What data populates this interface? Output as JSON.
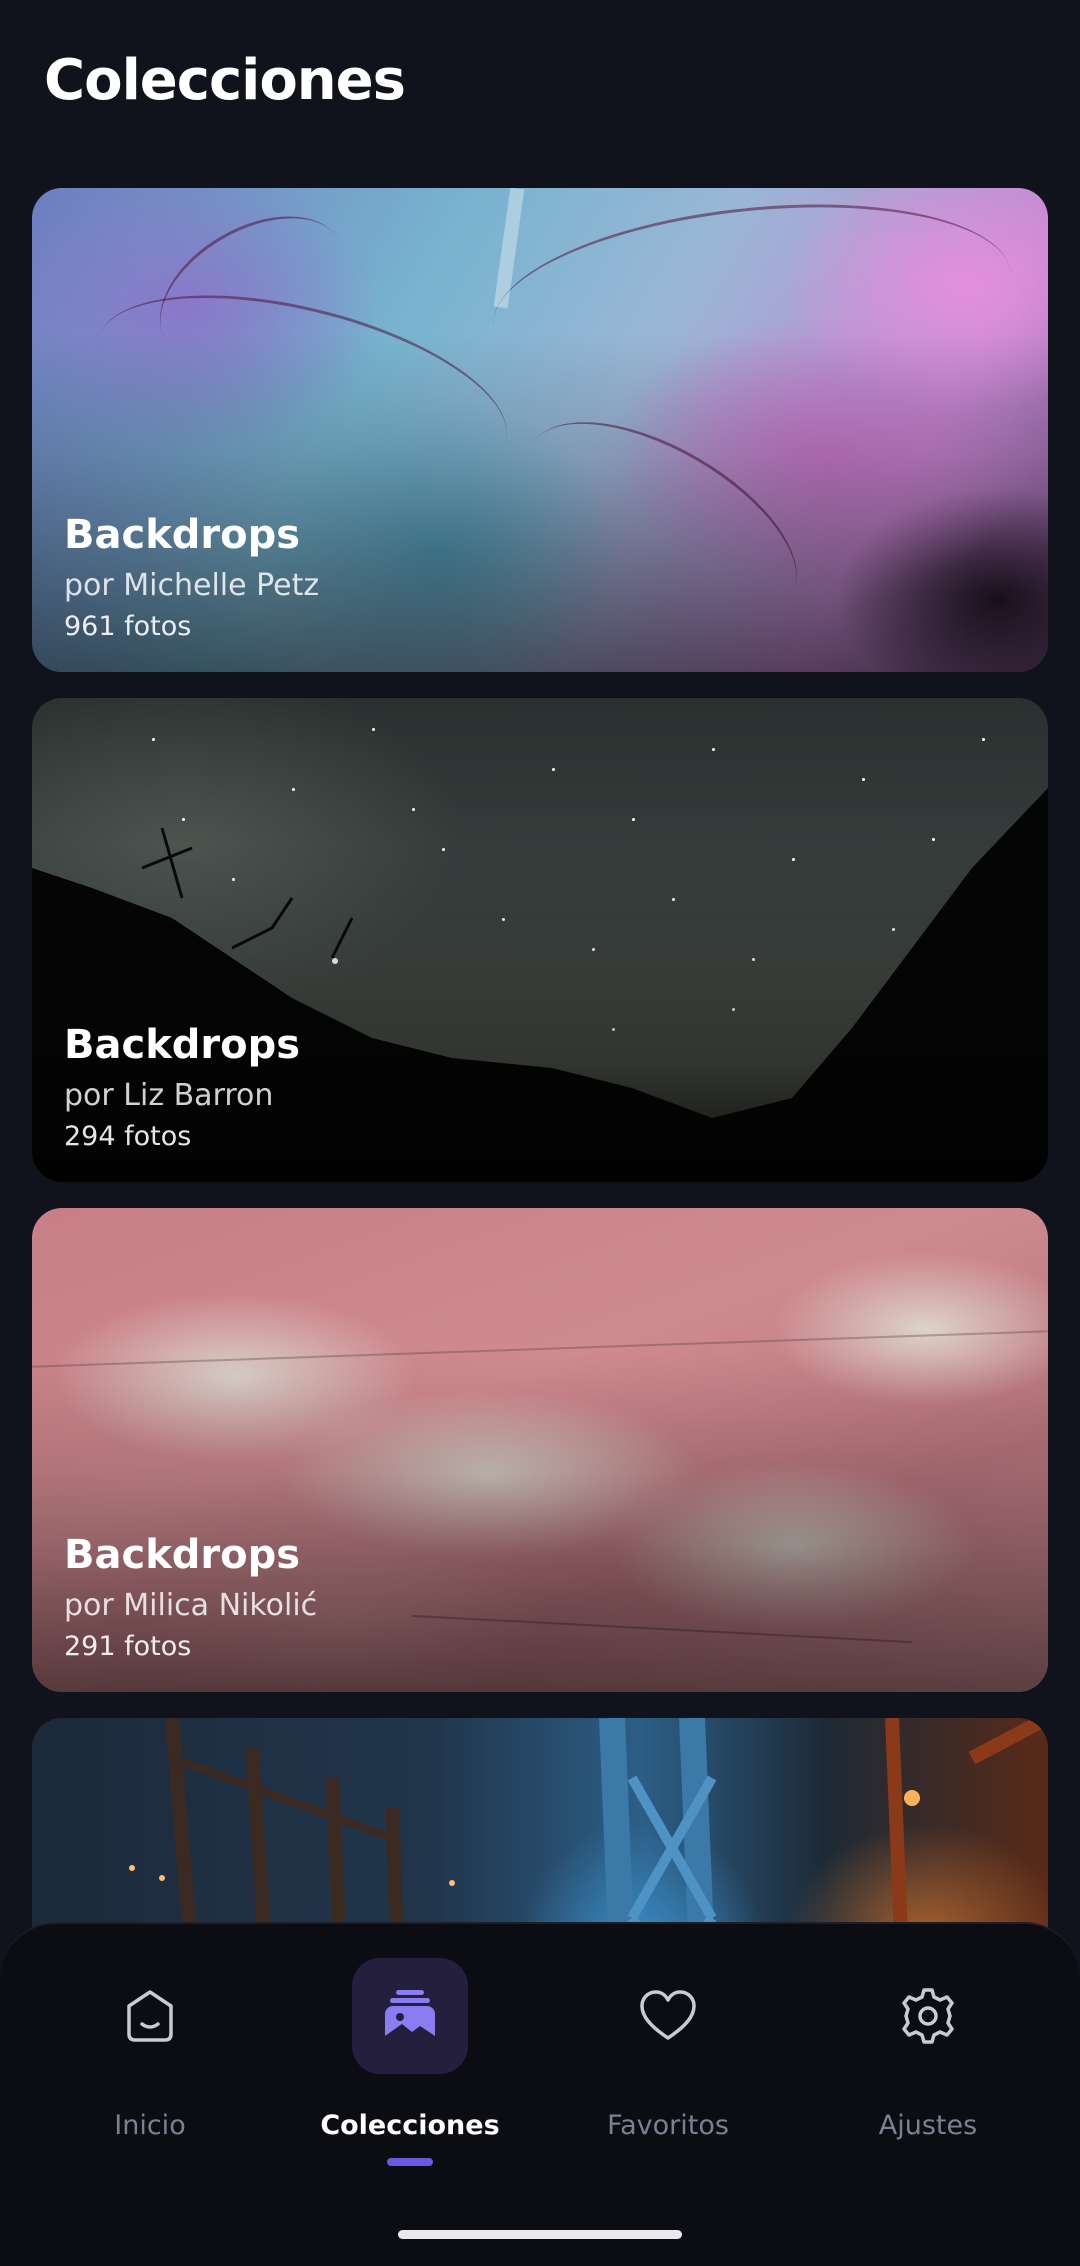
{
  "page_title": "Colecciones",
  "collections": [
    {
      "title": "Backdrops",
      "author": "por Michelle Petz",
      "count": "961 fotos"
    },
    {
      "title": "Backdrops",
      "author": "por Liz Barron",
      "count": "294 fotos"
    },
    {
      "title": "Backdrops",
      "author": "por Milica Nikolić",
      "count": "291 fotos"
    }
  ],
  "nav": {
    "items": [
      {
        "label": "Inicio",
        "icon": "smile-box-icon"
      },
      {
        "label": "Colecciones",
        "icon": "photo-stack-icon"
      },
      {
        "label": "Favoritos",
        "icon": "heart-icon"
      },
      {
        "label": "Ajustes",
        "icon": "gear-icon"
      }
    ],
    "active_index": 1
  },
  "colors": {
    "background": "#10131b",
    "nav_background": "#0b0d12",
    "accent": "#6a5ae0",
    "inactive_label": "#7d7f93"
  }
}
